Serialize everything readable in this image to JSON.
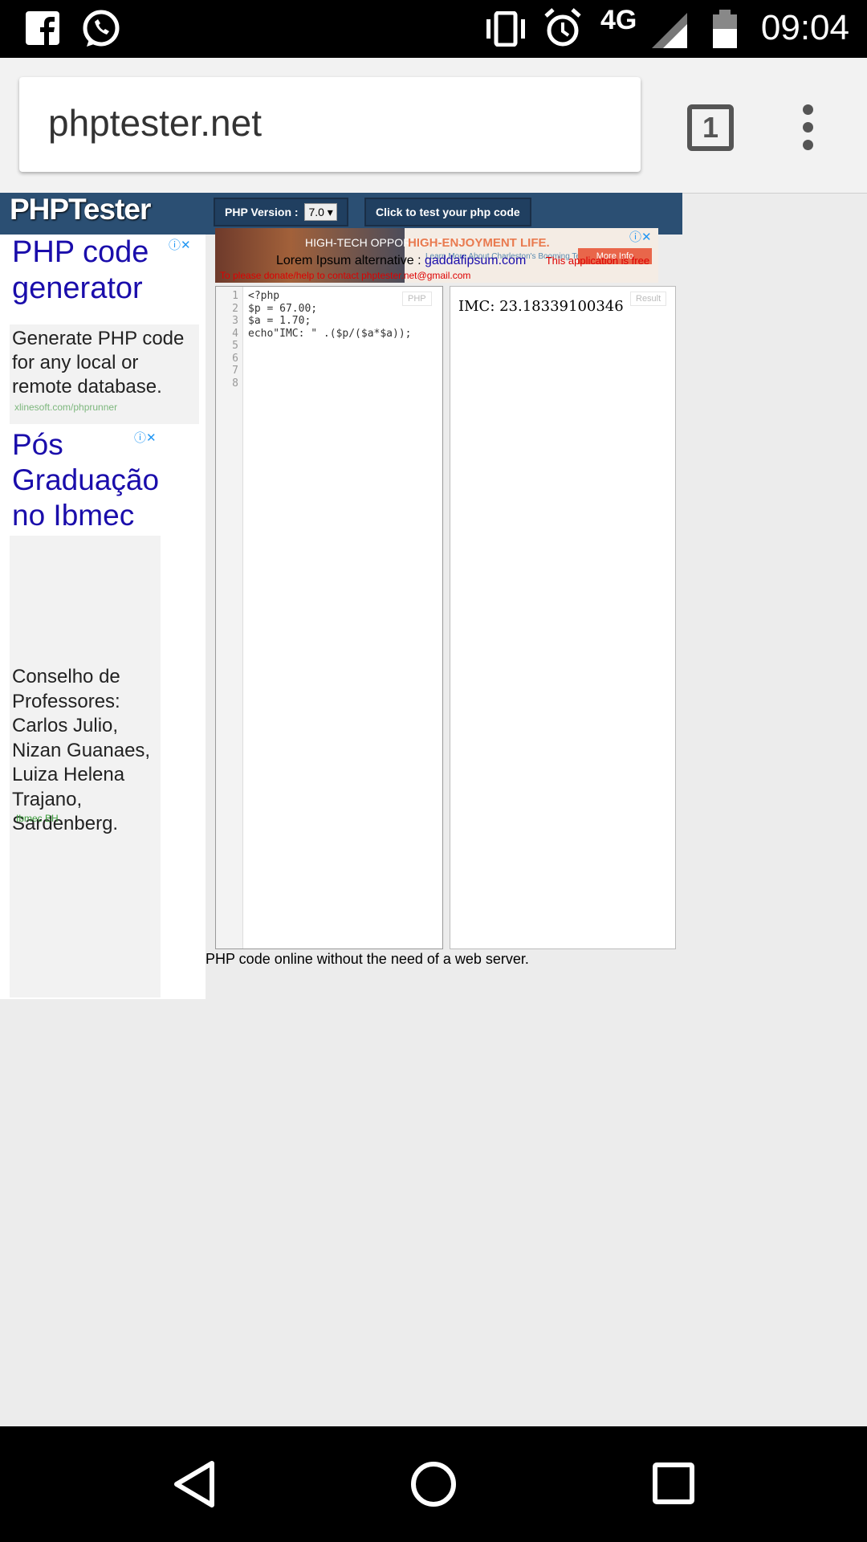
{
  "status_bar": {
    "time": "09:04",
    "network": "4G",
    "icons": [
      "facebook-icon",
      "whatsapp-icon",
      "vibrate-icon",
      "alarm-icon",
      "signal-icon",
      "battery-icon"
    ]
  },
  "browser": {
    "url": "phptester.net",
    "tab_count": "1"
  },
  "site": {
    "logo": "PHPTester",
    "php_version_label": "PHP Version :",
    "php_version_value": "7.0",
    "test_button": "Click to test your php code",
    "description": "PHP code online without the need of a web server."
  },
  "ads": {
    "ad1": {
      "title": "PHP code generator",
      "body": "Generate PHP code for any local or remote database.",
      "url": "xlinesoft.com/phprunner"
    },
    "ad2": {
      "title": "Pós Graduação no Ibmec",
      "body": "Conselho de Professores: Carlos Julio, Nizan Guanaes, Luiza Helena Trajano, Sardenberg.",
      "url": "Ibmec BH"
    },
    "banner": {
      "left_text": "HIGH-TECH OPPORTUNITIES",
      "right_text": "HIGH-ENJOYMENT LIFE.",
      "sub_text": "Learn More About Charleston's Booming Tech Scene.",
      "button": "More Info"
    }
  },
  "overlay": {
    "line1_prefix": "Lorem Ipsum alternative :",
    "line1_link": "gaddafipsum.com",
    "line1_note": "This application is free",
    "line2": "To please donate/help to contact phptester.net@gmail.com"
  },
  "editor": {
    "tag": "PHP",
    "line_numbers": [
      "1",
      "2",
      "3",
      "4",
      "5",
      "6",
      "7",
      "8"
    ],
    "lines": [
      "<?php",
      "$p = 67.00;",
      "$a = 1.70;",
      "echo\"IMC: \" .($p/($a*$a));"
    ]
  },
  "result": {
    "tag": "Result",
    "output": "IMC: 23.18339100346"
  },
  "colors": {
    "header": "#2b4f73",
    "ad_link": "#1a0dab"
  }
}
